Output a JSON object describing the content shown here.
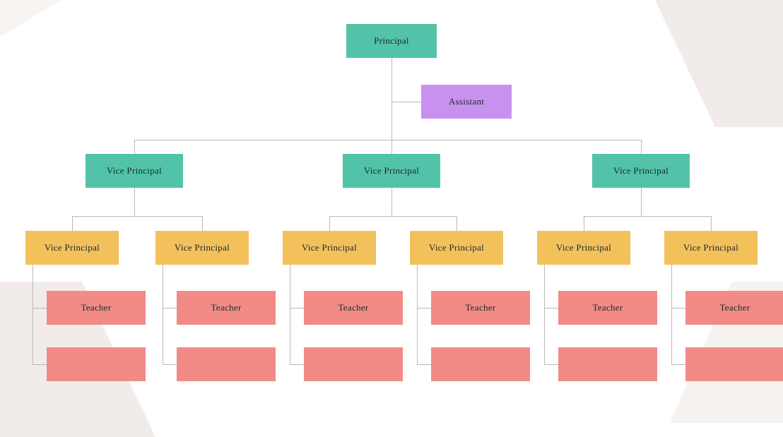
{
  "chart_data": {
    "type": "org-chart",
    "root": {
      "label": "Principal",
      "color": "#52c3a8",
      "assistant": {
        "label": "Assistant",
        "color": "#c891f0"
      },
      "children": [
        {
          "label": "Vice Principal",
          "color": "#52c3a8",
          "children": [
            {
              "label": "Vice Principal",
              "color": "#f3c15c",
              "children": [
                {
                  "label": "Teacher",
                  "color": "#f28a86"
                },
                {
                  "label": "",
                  "color": "#f28a86"
                }
              ]
            },
            {
              "label": "Vice Principal",
              "color": "#f3c15c",
              "children": [
                {
                  "label": "Teacher",
                  "color": "#f28a86"
                },
                {
                  "label": "",
                  "color": "#f28a86"
                }
              ]
            }
          ]
        },
        {
          "label": "Vice Principal",
          "color": "#52c3a8",
          "children": [
            {
              "label": "Vice Principal",
              "color": "#f3c15c",
              "children": [
                {
                  "label": "Teacher",
                  "color": "#f28a86"
                },
                {
                  "label": "",
                  "color": "#f28a86"
                }
              ]
            },
            {
              "label": "Vice Principal",
              "color": "#f3c15c",
              "children": [
                {
                  "label": "Teacher",
                  "color": "#f28a86"
                },
                {
                  "label": "",
                  "color": "#f28a86"
                }
              ]
            }
          ]
        },
        {
          "label": "Vice Principal",
          "color": "#52c3a8",
          "children": [
            {
              "label": "Vice Principal",
              "color": "#f3c15c",
              "children": [
                {
                  "label": "Teacher",
                  "color": "#f28a86"
                },
                {
                  "label": "",
                  "color": "#f28a86"
                }
              ]
            },
            {
              "label": "Vice Principal",
              "color": "#f3c15c",
              "children": [
                {
                  "label": "Teacher",
                  "color": "#f28a86"
                },
                {
                  "label": "",
                  "color": "#f28a86"
                }
              ]
            }
          ]
        }
      ]
    }
  },
  "nodes": {
    "principal": "Principal",
    "assistant": "Assistant",
    "vp1": "Vice Principal",
    "vp2": "Vice Principal",
    "vp3": "Vice Principal",
    "vp1a": "Vice Principal",
    "vp1b": "Vice Principal",
    "vp2a": "Vice Principal",
    "vp2b": "Vice Principal",
    "vp3a": "Vice Principal",
    "vp3b": "Vice Principal",
    "t1": "Teacher",
    "t2": "Teacher",
    "t3": "Teacher",
    "t4": "Teacher",
    "t5": "Teacher",
    "t6": "Teacher"
  }
}
